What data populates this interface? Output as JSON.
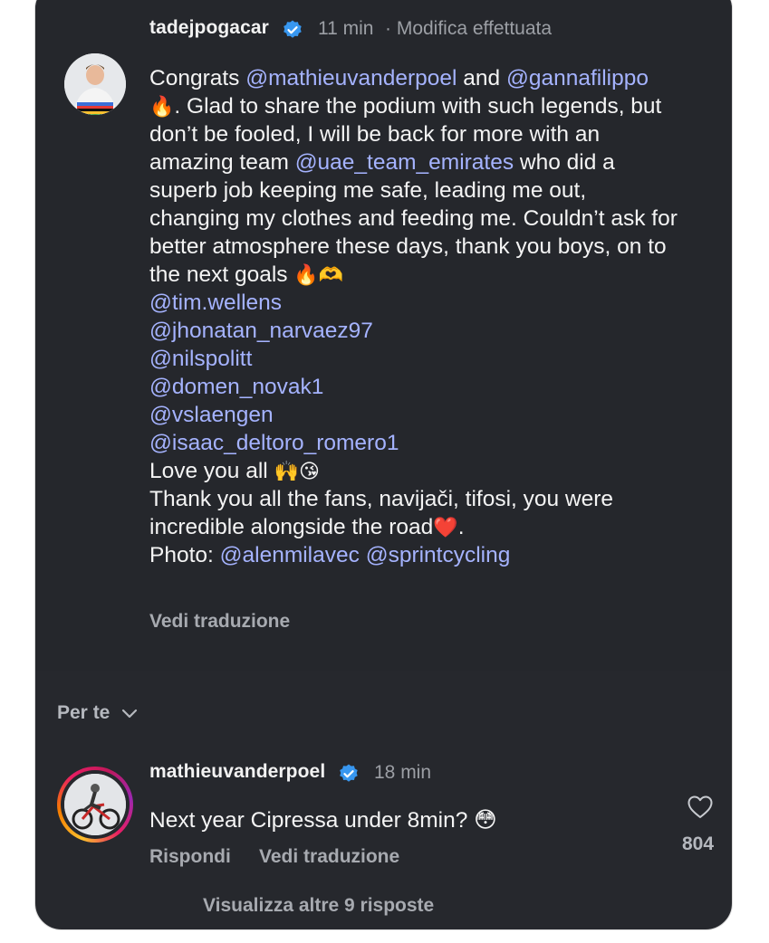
{
  "post": {
    "author": "tadejpogacar",
    "time": "11 min",
    "edited": "· Modifica effettuata",
    "lines": [
      [
        {
          "t": "Congrats "
        },
        {
          "t": "@mathieuvanderpoel",
          "m": true
        },
        {
          "t": " and "
        },
        {
          "t": "@gannafilippo",
          "m": true
        }
      ],
      [
        {
          "t": "🔥",
          "e": true
        },
        {
          "t": ". Glad to share the podium with such legends, but"
        }
      ],
      [
        {
          "t": "don’t be fooled, I will be back for more with an"
        }
      ],
      [
        {
          "t": "amazing team "
        },
        {
          "t": "@uae_team_emirates",
          "m": true
        },
        {
          "t": " who did a"
        }
      ],
      [
        {
          "t": "superb job keeping me safe, leading me out,"
        }
      ],
      [
        {
          "t": "changing my clothes and feeding me. Couldn’t ask for"
        }
      ],
      [
        {
          "t": "better atmosphere these days, thank you boys, on to"
        }
      ],
      [
        {
          "t": "the next goals "
        },
        {
          "t": "🔥🫶",
          "e": true
        }
      ],
      [
        {
          "t": "@tim.wellens",
          "m": true
        }
      ],
      [
        {
          "t": "@jhonatan_narvaez97",
          "m": true
        }
      ],
      [
        {
          "t": "@nilspolitt",
          "m": true
        }
      ],
      [
        {
          "t": "@domen_novak1",
          "m": true
        }
      ],
      [
        {
          "t": "@vslaengen",
          "m": true
        }
      ],
      [
        {
          "t": "@isaac_deltoro_romero1",
          "m": true
        }
      ],
      [
        {
          "t": "Love you all "
        },
        {
          "t": "🙌😘",
          "e": true
        }
      ],
      [
        {
          "t": " "
        }
      ],
      [
        {
          "t": "Thank you all the fans, navijači, tifosi, you were"
        }
      ],
      [
        {
          "t": "incredible alongside the road"
        },
        {
          "t": "❤️",
          "e": true
        },
        {
          "t": "."
        }
      ],
      [
        {
          "t": "Photo: "
        },
        {
          "t": "@alenmilavec",
          "m": true
        },
        {
          "t": " "
        },
        {
          "t": "@sprintcycling",
          "m": true
        }
      ]
    ],
    "translate_label": "Vedi traduzione"
  },
  "filter": {
    "label": "Per te"
  },
  "comment": {
    "author": "mathieuvanderpoel",
    "time": "18 min",
    "text": "Next year Cipressa under 8min? 😳",
    "reply_label": "Rispondi",
    "translate_label": "Vedi traduzione",
    "likes": "804",
    "more_replies": "Visualizza altre 9 risposte"
  },
  "colors": {
    "background": "#26282d",
    "mention": "#a5b3ff",
    "verified": "#3897f0"
  },
  "icons": [
    "verified-badge-icon",
    "chevron-down-icon",
    "heart-icon"
  ]
}
